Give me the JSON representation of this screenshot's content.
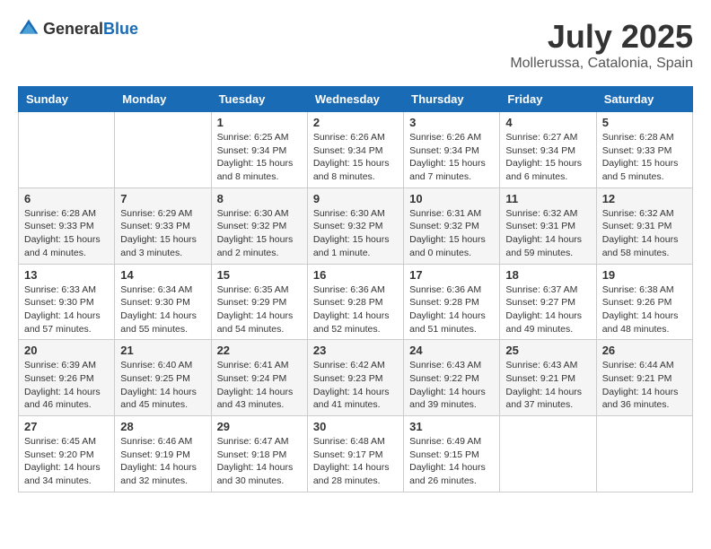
{
  "header": {
    "logo_general": "General",
    "logo_blue": "Blue",
    "month_title": "July 2025",
    "location": "Mollerussa, Catalonia, Spain"
  },
  "days_of_week": [
    "Sunday",
    "Monday",
    "Tuesday",
    "Wednesday",
    "Thursday",
    "Friday",
    "Saturday"
  ],
  "weeks": [
    [
      {
        "day": "",
        "detail": ""
      },
      {
        "day": "",
        "detail": ""
      },
      {
        "day": "1",
        "detail": "Sunrise: 6:25 AM\nSunset: 9:34 PM\nDaylight: 15 hours and 8 minutes."
      },
      {
        "day": "2",
        "detail": "Sunrise: 6:26 AM\nSunset: 9:34 PM\nDaylight: 15 hours and 8 minutes."
      },
      {
        "day": "3",
        "detail": "Sunrise: 6:26 AM\nSunset: 9:34 PM\nDaylight: 15 hours and 7 minutes."
      },
      {
        "day": "4",
        "detail": "Sunrise: 6:27 AM\nSunset: 9:34 PM\nDaylight: 15 hours and 6 minutes."
      },
      {
        "day": "5",
        "detail": "Sunrise: 6:28 AM\nSunset: 9:33 PM\nDaylight: 15 hours and 5 minutes."
      }
    ],
    [
      {
        "day": "6",
        "detail": "Sunrise: 6:28 AM\nSunset: 9:33 PM\nDaylight: 15 hours and 4 minutes."
      },
      {
        "day": "7",
        "detail": "Sunrise: 6:29 AM\nSunset: 9:33 PM\nDaylight: 15 hours and 3 minutes."
      },
      {
        "day": "8",
        "detail": "Sunrise: 6:30 AM\nSunset: 9:32 PM\nDaylight: 15 hours and 2 minutes."
      },
      {
        "day": "9",
        "detail": "Sunrise: 6:30 AM\nSunset: 9:32 PM\nDaylight: 15 hours and 1 minute."
      },
      {
        "day": "10",
        "detail": "Sunrise: 6:31 AM\nSunset: 9:32 PM\nDaylight: 15 hours and 0 minutes."
      },
      {
        "day": "11",
        "detail": "Sunrise: 6:32 AM\nSunset: 9:31 PM\nDaylight: 14 hours and 59 minutes."
      },
      {
        "day": "12",
        "detail": "Sunrise: 6:32 AM\nSunset: 9:31 PM\nDaylight: 14 hours and 58 minutes."
      }
    ],
    [
      {
        "day": "13",
        "detail": "Sunrise: 6:33 AM\nSunset: 9:30 PM\nDaylight: 14 hours and 57 minutes."
      },
      {
        "day": "14",
        "detail": "Sunrise: 6:34 AM\nSunset: 9:30 PM\nDaylight: 14 hours and 55 minutes."
      },
      {
        "day": "15",
        "detail": "Sunrise: 6:35 AM\nSunset: 9:29 PM\nDaylight: 14 hours and 54 minutes."
      },
      {
        "day": "16",
        "detail": "Sunrise: 6:36 AM\nSunset: 9:28 PM\nDaylight: 14 hours and 52 minutes."
      },
      {
        "day": "17",
        "detail": "Sunrise: 6:36 AM\nSunset: 9:28 PM\nDaylight: 14 hours and 51 minutes."
      },
      {
        "day": "18",
        "detail": "Sunrise: 6:37 AM\nSunset: 9:27 PM\nDaylight: 14 hours and 49 minutes."
      },
      {
        "day": "19",
        "detail": "Sunrise: 6:38 AM\nSunset: 9:26 PM\nDaylight: 14 hours and 48 minutes."
      }
    ],
    [
      {
        "day": "20",
        "detail": "Sunrise: 6:39 AM\nSunset: 9:26 PM\nDaylight: 14 hours and 46 minutes."
      },
      {
        "day": "21",
        "detail": "Sunrise: 6:40 AM\nSunset: 9:25 PM\nDaylight: 14 hours and 45 minutes."
      },
      {
        "day": "22",
        "detail": "Sunrise: 6:41 AM\nSunset: 9:24 PM\nDaylight: 14 hours and 43 minutes."
      },
      {
        "day": "23",
        "detail": "Sunrise: 6:42 AM\nSunset: 9:23 PM\nDaylight: 14 hours and 41 minutes."
      },
      {
        "day": "24",
        "detail": "Sunrise: 6:43 AM\nSunset: 9:22 PM\nDaylight: 14 hours and 39 minutes."
      },
      {
        "day": "25",
        "detail": "Sunrise: 6:43 AM\nSunset: 9:21 PM\nDaylight: 14 hours and 37 minutes."
      },
      {
        "day": "26",
        "detail": "Sunrise: 6:44 AM\nSunset: 9:21 PM\nDaylight: 14 hours and 36 minutes."
      }
    ],
    [
      {
        "day": "27",
        "detail": "Sunrise: 6:45 AM\nSunset: 9:20 PM\nDaylight: 14 hours and 34 minutes."
      },
      {
        "day": "28",
        "detail": "Sunrise: 6:46 AM\nSunset: 9:19 PM\nDaylight: 14 hours and 32 minutes."
      },
      {
        "day": "29",
        "detail": "Sunrise: 6:47 AM\nSunset: 9:18 PM\nDaylight: 14 hours and 30 minutes."
      },
      {
        "day": "30",
        "detail": "Sunrise: 6:48 AM\nSunset: 9:17 PM\nDaylight: 14 hours and 28 minutes."
      },
      {
        "day": "31",
        "detail": "Sunrise: 6:49 AM\nSunset: 9:15 PM\nDaylight: 14 hours and 26 minutes."
      },
      {
        "day": "",
        "detail": ""
      },
      {
        "day": "",
        "detail": ""
      }
    ]
  ]
}
